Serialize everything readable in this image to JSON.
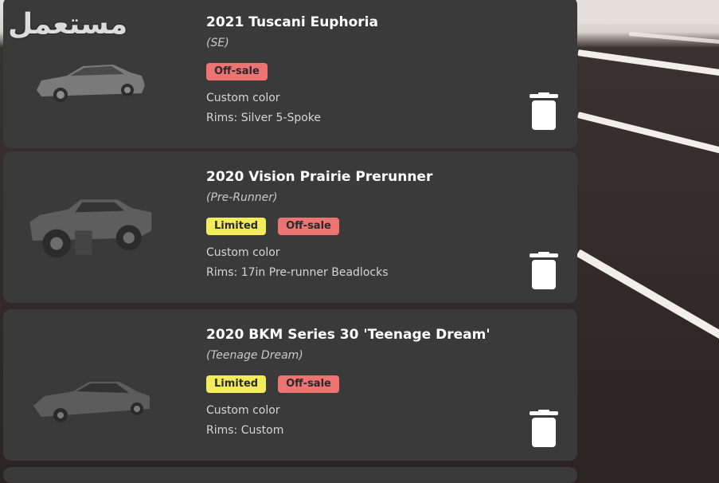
{
  "watermark": {
    "text": "مستعمل"
  },
  "cars": [
    {
      "title": "2021 Tuscani Euphoria",
      "trim": "(SE)",
      "tags": [
        {
          "label": "Off-sale",
          "kind": "offsale"
        }
      ],
      "color_line": "Custom color",
      "rims_line": "Rims: Silver 5-Spoke",
      "thumbnail_icon": "sedan-thumbnail"
    },
    {
      "title": "2020 Vision Prairie Prerunner",
      "trim": "(Pre-Runner)",
      "tags": [
        {
          "label": "Limited",
          "kind": "limited"
        },
        {
          "label": "Off-sale",
          "kind": "offsale"
        }
      ],
      "color_line": "Custom color",
      "rims_line": "Rims: 17in Pre-runner Beadlocks",
      "thumbnail_icon": "truck-thumbnail"
    },
    {
      "title": "2020 BKM Series 30 'Teenage Dream'",
      "trim": "(Teenage Dream)",
      "tags": [
        {
          "label": "Limited",
          "kind": "limited"
        },
        {
          "label": "Off-sale",
          "kind": "offsale"
        }
      ],
      "color_line": "Custom color",
      "rims_line": "Rims: Custom",
      "thumbnail_icon": "sedan-thumbnail"
    }
  ],
  "colors": {
    "card": "#3b3a3b",
    "limited": "#f2ec5b",
    "offsale": "#ee7373"
  }
}
